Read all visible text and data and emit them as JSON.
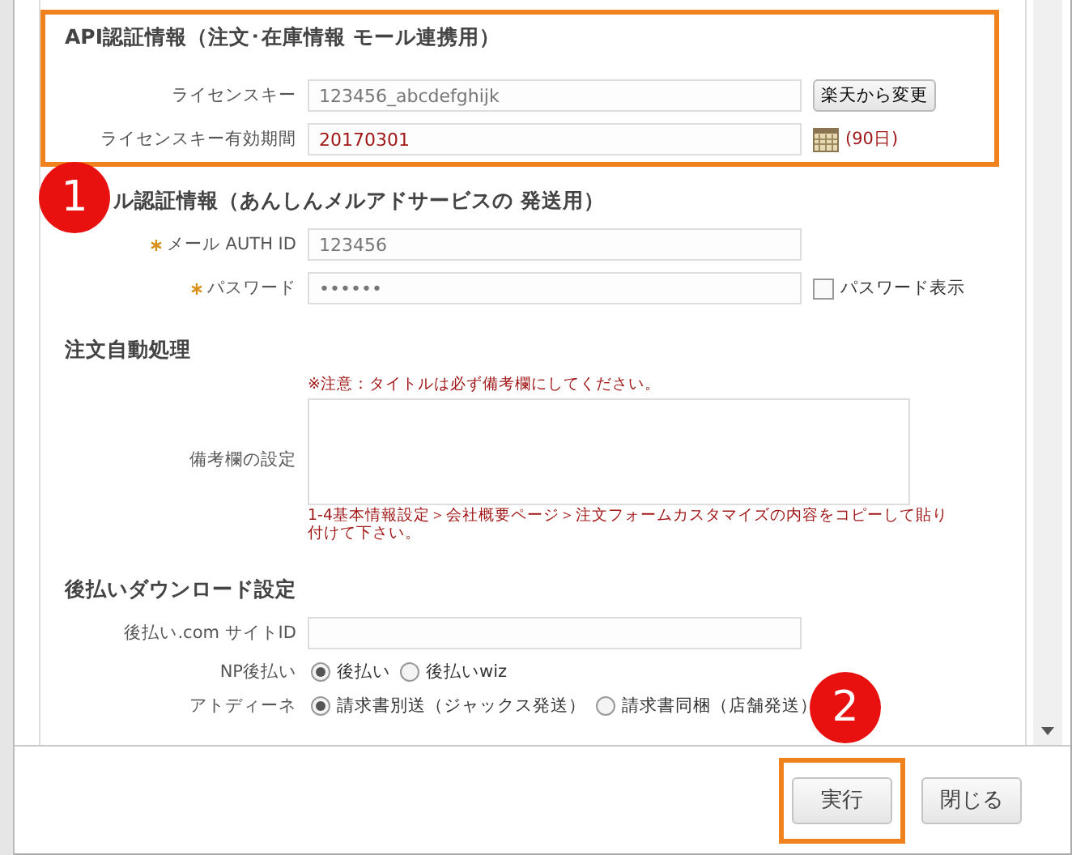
{
  "sections": [
    {
      "title": "API認証情報（注文･在庫情報 モール連携用）",
      "highlighted": true,
      "rows": [
        {
          "kind": "text",
          "label": "ライセンスキー",
          "value": "123456_abcdefghijk",
          "button": "楽天から変更"
        },
        {
          "kind": "date",
          "label": "ライセンスキー有効期間",
          "value": "20170301",
          "note": "(90日)"
        }
      ]
    },
    {
      "title": "ル認証情報（あんしんメルアドサービスの 発送用）",
      "highlighted": false,
      "badge": "1",
      "rows": [
        {
          "kind": "text",
          "label": "メール AUTH ID",
          "required": true,
          "value": "123456"
        },
        {
          "kind": "password",
          "label": "パスワード",
          "required": true,
          "value": "••••••",
          "checkbox": {
            "label": "パスワード表示",
            "checked": false
          }
        }
      ]
    },
    {
      "title": "注文自動処理",
      "highlighted": false,
      "rows": [
        {
          "kind": "textarea",
          "label": "備考欄の設定",
          "notice": "※注意：タイトルは必ず備考欄にしてください。",
          "hint": "1-4基本情報設定＞会社概要ページ＞注文フォームカスタマイズの内容をコピーして貼り付けて下さい。"
        }
      ]
    },
    {
      "title": "後払いダウンロード設定",
      "highlighted": false,
      "rows": [
        {
          "kind": "text",
          "label": "後払い.com サイトID",
          "value": ""
        },
        {
          "kind": "radio",
          "label": "NP後払い",
          "options": [
            {
              "label": "後払い",
              "selected": true
            },
            {
              "label": "後払いwiz",
              "selected": false
            }
          ]
        },
        {
          "kind": "radio",
          "label": "アトディーネ",
          "options": [
            {
              "label": "請求書別送（ジャックス発送）",
              "selected": true
            },
            {
              "label": "請求書同梱（店舗発送）",
              "selected": false
            }
          ]
        }
      ]
    }
  ],
  "badge": "2",
  "buttons": [
    {
      "label": "実行",
      "highlighted": true
    },
    {
      "label": "閉じる",
      "highlighted": false
    }
  ]
}
